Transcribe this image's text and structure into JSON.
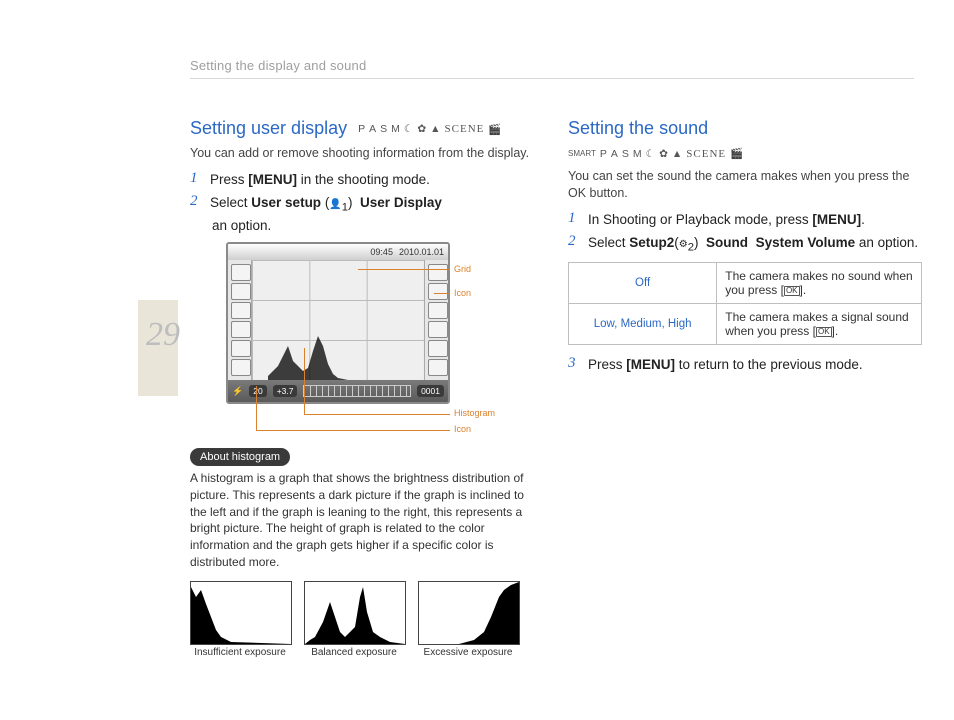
{
  "breadcrumb": "Setting the display and sound",
  "page_number": "29",
  "left": {
    "heading": "Setting user display",
    "lead": "You can add or remove shooting information from the display.",
    "step1": {
      "pre": "Press ",
      "bold": "[MENU]",
      "post": " in the shooting mode."
    },
    "step2": {
      "pre": "Select ",
      "b1": "User setup",
      "mid": " (",
      "icon_sub": "1",
      "mid2": ") ",
      "b2": "User Display",
      "post": " an option."
    },
    "lcd": {
      "time": "09:45",
      "date": "2010.01.01",
      "shots": "20",
      "ev": "+3.7",
      "counter": "0001",
      "callouts": {
        "grid": "Grid",
        "icon_top": "Icon",
        "histogram": "Histogram",
        "icon_bottom": "Icon"
      }
    },
    "chip": "About histogram",
    "about": "A histogram is a graph that shows the brightness distribution of picture. This represents a dark picture if the graph is inclined to the left and if the graph is leaning to the right, this represents a bright picture. The height of graph is related to the color information and the graph gets higher if a specific color is distributed more.",
    "trio": {
      "a": "Insufficient exposure",
      "b": "Balanced exposure",
      "c": "Excessive exposure"
    }
  },
  "right": {
    "heading": "Setting the sound",
    "lead": "You can set the sound the camera makes when you press the OK button.",
    "step1": {
      "pre": "In Shooting or Playback mode, press ",
      "bold": "[MENU]",
      "post": "."
    },
    "step2": {
      "pre": "Select ",
      "b1": "Setup2",
      "mid": "(",
      "icon_sub": "2",
      "mid2": ") ",
      "b2": "Sound",
      "b3": "System Volume",
      "post": " an option."
    },
    "table": {
      "row1": {
        "key": "Off",
        "val_pre": "The camera makes no sound when you press [",
        "val_post": "]."
      },
      "row2": {
        "key": "Low, Medium, High",
        "val_pre": "The camera makes a signal sound when you press [",
        "val_post": "]."
      }
    },
    "ok_label": "OK",
    "step3": {
      "pre": "Press ",
      "bold": "[MENU]",
      "post": " to return to the previous mode."
    }
  },
  "modes": {
    "smart": "SMART",
    "p": "P",
    "a": "A",
    "s": "S",
    "m": "M",
    "scene": "SCENE"
  }
}
